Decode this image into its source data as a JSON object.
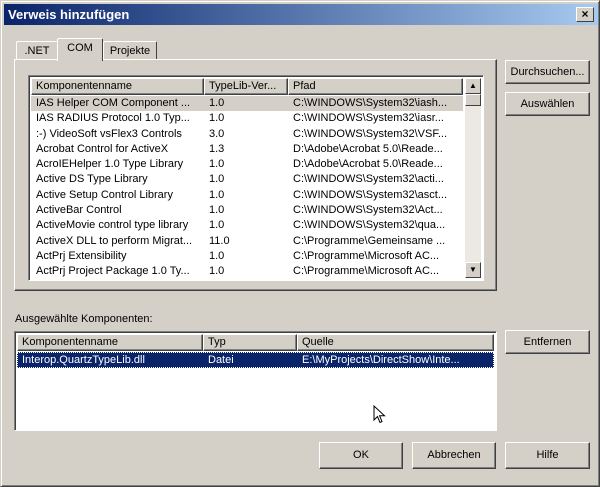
{
  "window": {
    "title": "Verweis hinzufügen",
    "close_glyph": "×"
  },
  "tabs": [
    {
      "label": ".NET",
      "active": false
    },
    {
      "label": "COM",
      "active": true
    },
    {
      "label": "Projekte",
      "active": false
    }
  ],
  "components_list": {
    "columns": [
      "Komponentenname",
      "TypeLib-Ver...",
      "Pfad"
    ],
    "rows": [
      {
        "name": "IAS Helper COM Component ...",
        "version": "1.0",
        "path": "C:\\WINDOWS\\System32\\iash..."
      },
      {
        "name": "IAS RADIUS Protocol 1.0 Typ...",
        "version": "1.0",
        "path": "C:\\WINDOWS\\System32\\iasr..."
      },
      {
        "name": ":-) VideoSoft vsFlex3 Controls",
        "version": "3.0",
        "path": "C:\\WINDOWS\\System32\\VSF..."
      },
      {
        "name": "Acrobat Control for ActiveX",
        "version": "1.3",
        "path": "D:\\Adobe\\Acrobat 5.0\\Reade..."
      },
      {
        "name": "AcroIEHelper 1.0 Type Library",
        "version": "1.0",
        "path": "D:\\Adobe\\Acrobat 5.0\\Reade..."
      },
      {
        "name": "Active DS Type Library",
        "version": "1.0",
        "path": "C:\\WINDOWS\\System32\\acti..."
      },
      {
        "name": "Active Setup Control Library",
        "version": "1.0",
        "path": "C:\\WINDOWS\\System32\\asct..."
      },
      {
        "name": "ActiveBar Control",
        "version": "1.0",
        "path": "C:\\WINDOWS\\System32\\Act..."
      },
      {
        "name": "ActiveMovie control type library",
        "version": "1.0",
        "path": "C:\\WINDOWS\\System32\\qua..."
      },
      {
        "name": "ActiveX DLL to perform Migrat...",
        "version": "11.0",
        "path": "C:\\Programme\\Gemeinsame ..."
      },
      {
        "name": "ActPrj Extensibility",
        "version": "1.0",
        "path": "C:\\Programme\\Microsoft AC..."
      },
      {
        "name": "ActPrj Project Package 1.0 Ty...",
        "version": "1.0",
        "path": "C:\\Programme\\Microsoft AC..."
      }
    ]
  },
  "side_buttons": {
    "browse": "Durchsuchen...",
    "select": "Auswählen",
    "remove": "Entfernen"
  },
  "selected_section": {
    "label": "Ausgewählte Komponenten:",
    "columns": [
      "Komponentenname",
      "Typ",
      "Quelle"
    ],
    "rows": [
      {
        "name": "Interop.QuartzTypeLib.dll",
        "type": "Datei",
        "source": "E:\\MyProjects\\DirectShow\\Inte..."
      }
    ]
  },
  "bottom_buttons": {
    "ok": "OK",
    "cancel": "Abbrechen",
    "help": "Hilfe"
  },
  "colors": {
    "face": "#d4d0c8",
    "title_start": "#0a246a",
    "title_end": "#a6caf0",
    "selection": "#0a246a"
  }
}
